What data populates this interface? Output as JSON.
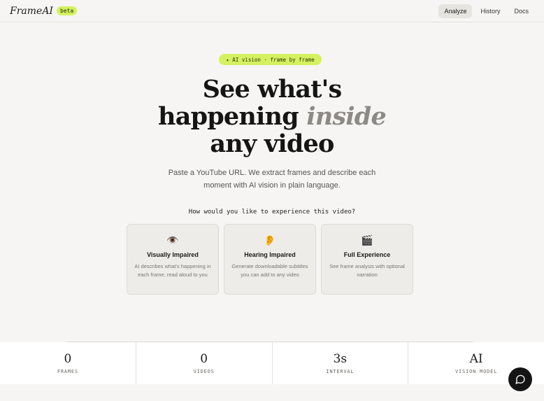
{
  "header": {
    "logo": "FrameAI",
    "badge": "beta",
    "nav": [
      "Analyze",
      "History",
      "Docs"
    ]
  },
  "hero": {
    "pill": "✦ AI vision · frame by frame",
    "title_line1": "See what's",
    "title_line2_main": "happening",
    "title_line2_accent": "inside",
    "title_line3": "any video",
    "subtitle_line1": "Paste a YouTube URL. We extract frames and describe each",
    "subtitle_line2": "moment with AI vision in plain language.",
    "question": "How would you like to experience this video?"
  },
  "cards": [
    {
      "icon": "eye-icon",
      "emoji": "👁️",
      "title": "Visually Impaired",
      "desc": "AI describes what's happening in each frame, read aloud to you"
    },
    {
      "icon": "ear-icon",
      "emoji": "👂",
      "title": "Hearing Impaired",
      "desc": "Generate downloadable subtitles you can add to any video"
    },
    {
      "icon": "clapperboard-icon",
      "emoji": "🎬",
      "title": "Full Experience",
      "desc": "See frame analysis with optional narration"
    }
  ],
  "stats": [
    {
      "value": "0",
      "label": "FRAMES"
    },
    {
      "value": "0",
      "label": "VIDEOS"
    },
    {
      "value": "3s",
      "label": "INTERVAL"
    },
    {
      "value": "AI",
      "label": "VISION MODEL"
    }
  ],
  "colors": {
    "accent": "#d4f160",
    "background": "#f6f5f3",
    "card": "#eeece8",
    "dark": "#141414"
  }
}
